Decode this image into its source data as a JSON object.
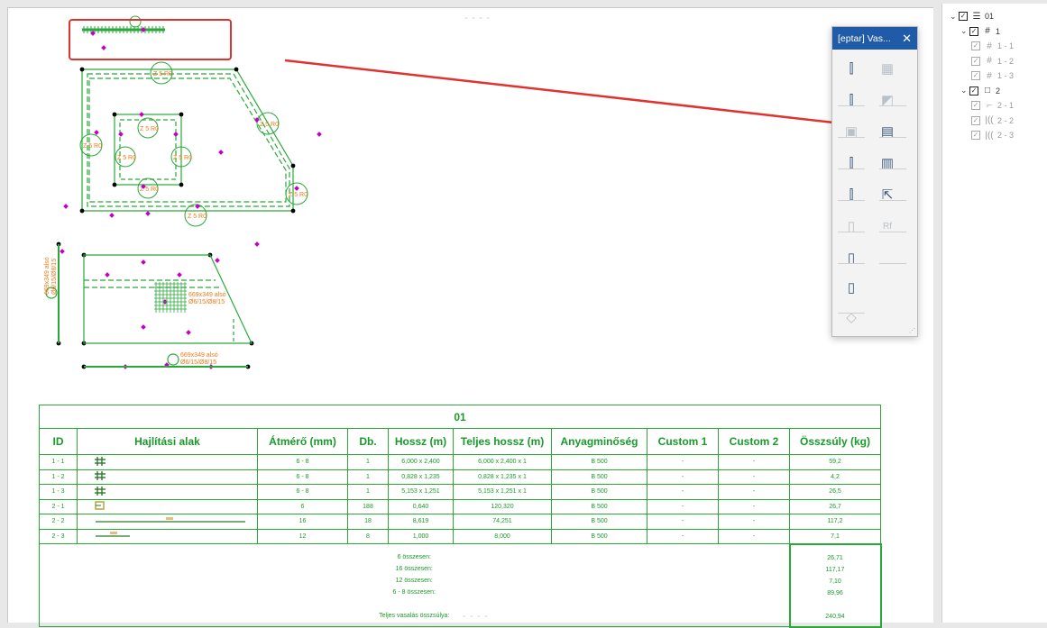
{
  "palette": {
    "title": "[eptar] Vas...",
    "close_glyph": "✕",
    "buttons": [
      {
        "name": "rebar-place-button",
        "icon": "rebar-place-icon",
        "enabled": true
      },
      {
        "name": "mesh-place-button",
        "icon": "mesh-icon",
        "enabled": false
      },
      {
        "name": "rebar-edit-button",
        "icon": "rebar-edit-icon",
        "enabled": true
      },
      {
        "name": "mesh-edit-button",
        "icon": "mesh-edit-icon",
        "enabled": false
      },
      {
        "name": "rebar-3d-button",
        "icon": "rebar-3d-icon",
        "enabled": false
      },
      {
        "name": "schedule-table-button",
        "icon": "table-icon",
        "enabled": true
      },
      {
        "name": "rebar-copy-button",
        "icon": "rebar-copy-icon",
        "enabled": true
      },
      {
        "name": "schedule-settings-button",
        "icon": "table-settings-icon",
        "enabled": true
      },
      {
        "name": "rebar-refresh-button",
        "icon": "rebar-refresh-icon",
        "enabled": true
      },
      {
        "name": "export-button",
        "icon": "export-icon",
        "enabled": true
      },
      {
        "name": "column-rebar-button",
        "icon": "column-icon",
        "enabled": false
      },
      {
        "name": "reference-button",
        "icon": "reference-icon",
        "enabled": false
      },
      {
        "name": "stirrup-button",
        "icon": "stirrup-icon",
        "enabled": true
      },
      {
        "name": "stirrup-edit-button",
        "icon": "stirrup-edit-icon",
        "enabled": true
      },
      {
        "name": "slab-button",
        "icon": "slab-icon",
        "enabled": false
      }
    ],
    "ref_label": "Rf"
  },
  "tree": [
    {
      "label": "01",
      "level": 0,
      "expanded": true,
      "icon": "list-icon",
      "checked": true,
      "dim": false
    },
    {
      "label": "1",
      "level": 1,
      "expanded": true,
      "icon": "mesh-icon",
      "checked": true,
      "dim": false
    },
    {
      "label": "1 - 1",
      "level": 2,
      "icon": "mesh-icon",
      "checked": true,
      "dim": true
    },
    {
      "label": "1 - 2",
      "level": 2,
      "icon": "mesh-icon",
      "checked": true,
      "dim": true
    },
    {
      "label": "1 - 3",
      "level": 2,
      "icon": "mesh-icon",
      "checked": true,
      "dim": true
    },
    {
      "label": "2",
      "level": 1,
      "expanded": true,
      "icon": "square-icon",
      "checked": true,
      "dim": false
    },
    {
      "label": "2 - 1",
      "level": 2,
      "icon": "stirrup-icon",
      "checked": true,
      "dim": true
    },
    {
      "label": "2 - 2",
      "level": 2,
      "icon": "bar-icon",
      "checked": true,
      "dim": true
    },
    {
      "label": "2 - 3",
      "level": 2,
      "icon": "bar-icon",
      "checked": true,
      "dim": true
    }
  ],
  "drawing": {
    "circle_label": "Z 5 R0",
    "mesh_label_1": "669x349 alsó",
    "mesh_label_2": "Ø6/15/Ø8/15"
  },
  "table": {
    "title": "01",
    "headers": [
      "ID",
      "Hajlítási alak",
      "Átmérő (mm)",
      "Db.",
      "Hossz (m)",
      "Teljes hossz (m)",
      "Anyagminőség",
      "Custom 1",
      "Custom 2",
      "Összsúly (kg)"
    ],
    "rows": [
      {
        "id": "1 - 1",
        "shape": "mesh",
        "d": "6 - 8",
        "db": "1",
        "len": "6,000 x 2,400",
        "total": "6,000 x 2,400 x 1",
        "mat": "B 500",
        "c1": "-",
        "c2": "-",
        "w": "59,2"
      },
      {
        "id": "1 - 2",
        "shape": "mesh",
        "d": "6 - 8",
        "db": "1",
        "len": "0,828 x 1,235",
        "total": "0,828 x 1,235 x 1",
        "mat": "B 500",
        "c1": "-",
        "c2": "-",
        "w": "4,2"
      },
      {
        "id": "1 - 3",
        "shape": "mesh",
        "d": "6 - 8",
        "db": "1",
        "len": "5,153 x 1,251",
        "total": "5,153 x 1,251 x 1",
        "mat": "B 500",
        "c1": "-",
        "c2": "-",
        "w": "26,5"
      },
      {
        "id": "2 - 1",
        "shape": "stirrup",
        "d": "6",
        "db": "188",
        "len": "0,640",
        "total": "120,320",
        "mat": "B 500",
        "c1": "-",
        "c2": "-",
        "w": "26,7"
      },
      {
        "id": "2 - 2",
        "shape": "long-bar",
        "d": "16",
        "db": "18",
        "len": "8,619",
        "total": "74,251",
        "mat": "B 500",
        "c1": "-",
        "c2": "-",
        "w": "117,2"
      },
      {
        "id": "2 - 3",
        "shape": "short-bar",
        "d": "12",
        "db": "8",
        "len": "1,000",
        "total": "8,000",
        "mat": "B 500",
        "c1": "-",
        "c2": "-",
        "w": "7,1"
      }
    ],
    "summary_labels": [
      "6 összesen:",
      "16 összesen:",
      "12 összesen:",
      "6 - 8 összesen:",
      "",
      "Teljes vasalás összsúlya:"
    ],
    "summary_values": [
      "26,71",
      "117,17",
      "7,10",
      "89,96",
      "",
      "240,94"
    ]
  },
  "colors": {
    "accent": "#1f5ba8",
    "drawing_green": "#2aa83a",
    "annotation_orange": "#f07a1a",
    "highlight_red": "#e0322e",
    "node_magenta": "#c400c4"
  }
}
